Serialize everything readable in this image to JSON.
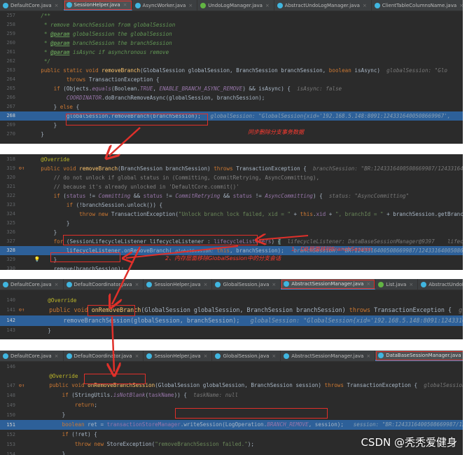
{
  "panel1": {
    "tabs": [
      {
        "label": "DefaultCore.java",
        "icon": "class-icon",
        "active": false
      },
      {
        "label": "SessionHelper.java",
        "icon": "class-icon",
        "active": true
      },
      {
        "label": "AsyncWorker.java",
        "icon": "class-icon",
        "active": false
      },
      {
        "label": "UndoLogManager.java",
        "icon": "interface-icon",
        "active": false
      },
      {
        "label": "AbstractUndoLogManager.java",
        "icon": "class-icon",
        "active": false
      },
      {
        "label": "ClientTableColumnsName.java",
        "icon": "class-icon",
        "active": false
      },
      {
        "label": "DefaultVal",
        "icon": "class-icon",
        "active": false
      }
    ],
    "lines": [
      {
        "n": "257",
        "g": ""
      },
      {
        "n": "258",
        "g": ""
      },
      {
        "n": "259",
        "g": ""
      },
      {
        "n": "260",
        "g": ""
      },
      {
        "n": "261",
        "g": ""
      },
      {
        "n": "262",
        "g": ""
      },
      {
        "n": "263",
        "g": ""
      },
      {
        "n": "264",
        "g": ""
      },
      {
        "n": "265",
        "g": ""
      },
      {
        "n": "266",
        "g": ""
      },
      {
        "n": "267",
        "g": ""
      },
      {
        "n": "268",
        "g": ""
      },
      {
        "n": "269",
        "g": ""
      },
      {
        "n": "270",
        "g": ""
      }
    ],
    "annotation": "同步删除分支事务数据"
  },
  "panel2": {
    "lines": [
      {
        "n": "318",
        "g": ""
      },
      {
        "n": "319",
        "g": "⊙↑"
      },
      {
        "n": "320",
        "g": ""
      },
      {
        "n": "321",
        "g": ""
      },
      {
        "n": "322",
        "g": ""
      },
      {
        "n": "323",
        "g": ""
      },
      {
        "n": "324",
        "g": ""
      },
      {
        "n": "325",
        "g": ""
      },
      {
        "n": "326",
        "g": ""
      },
      {
        "n": "327",
        "g": ""
      },
      {
        "n": "328",
        "g": ""
      },
      {
        "n": "329",
        "g": "💡"
      },
      {
        "n": "330",
        "g": ""
      },
      {
        "n": "331",
        "g": ""
      }
    ],
    "annotation1": "1、DB层面移除BranchSession",
    "annotation2": "2、内存层面移除GlobalSession中的分支会话"
  },
  "panel3": {
    "tabs": [
      {
        "label": "DefaultCore.java",
        "icon": "class-icon",
        "active": false
      },
      {
        "label": "DefaultCoordinator.java",
        "icon": "class-icon",
        "active": false
      },
      {
        "label": "SessionHelper.java",
        "icon": "class-icon",
        "active": false
      },
      {
        "label": "GlobalSession.java",
        "icon": "class-icon",
        "active": false
      },
      {
        "label": "AbstractSessionManager.java",
        "icon": "class-icon",
        "active": true
      },
      {
        "label": "List.java",
        "icon": "interface-icon",
        "active": false
      },
      {
        "label": "AbstractUndoLogManager.java",
        "icon": "class-icon",
        "active": false
      }
    ],
    "lines": [
      {
        "n": "140",
        "g": ""
      },
      {
        "n": "141",
        "g": "⊙↑"
      },
      {
        "n": "142",
        "g": ""
      },
      {
        "n": "143",
        "g": ""
      }
    ]
  },
  "panel4": {
    "tabs": [
      {
        "label": "DefaultCore.java",
        "icon": "class-icon",
        "active": false
      },
      {
        "label": "DefaultCoordinator.java",
        "icon": "class-icon",
        "active": false
      },
      {
        "label": "SessionHelper.java",
        "icon": "class-icon",
        "active": false
      },
      {
        "label": "GlobalSession.java",
        "icon": "class-icon",
        "active": false
      },
      {
        "label": "AbstractSessionManager.java",
        "icon": "class-icon",
        "active": false
      },
      {
        "label": "DataBaseSessionManager.java",
        "icon": "class-icon",
        "active": true
      },
      {
        "label": "List.java",
        "icon": "interface-icon",
        "active": false
      },
      {
        "label": "DefaultVa",
        "icon": "class-icon",
        "active": false
      }
    ],
    "lines": [
      {
        "n": "146",
        "g": ""
      },
      {
        "n": "147",
        "g": "⊙↑"
      },
      {
        "n": "148",
        "g": ""
      },
      {
        "n": "149",
        "g": ""
      },
      {
        "n": "150",
        "g": ""
      },
      {
        "n": "151",
        "g": ""
      },
      {
        "n": "152",
        "g": ""
      },
      {
        "n": "153",
        "g": ""
      },
      {
        "n": "154",
        "g": ""
      },
      {
        "n": "155",
        "g": ""
      }
    ]
  },
  "watermark": "CSDN @秃秃爱健身",
  "colors": {
    "editor_bg": "#2b2b2b",
    "highlight": "#2d6099",
    "annotation_red": "#e0302a",
    "keyword": "#cc7832",
    "method": "#ffc66d",
    "string": "#6a8759",
    "comment": "#808080"
  }
}
